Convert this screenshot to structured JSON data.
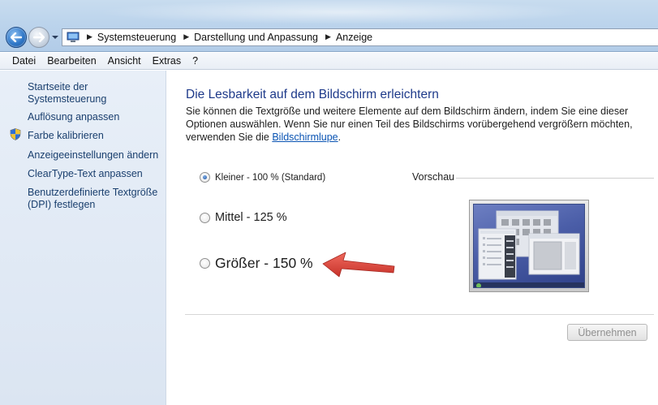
{
  "address_bar": {
    "breadcrumbs": [
      "Systemsteuerung",
      "Darstellung und Anpassung",
      "Anzeige"
    ]
  },
  "menu": [
    "Datei",
    "Bearbeiten",
    "Ansicht",
    "Extras",
    "?"
  ],
  "sidebar": {
    "home": "Startseite der Systemsteuerung",
    "links": [
      "Auflösung anpassen",
      "Farbe kalibrieren",
      "Anzeigeeinstellungen ändern",
      "ClearType-Text anpassen",
      "Benutzerdefinierte Textgröße (DPI) festlegen"
    ]
  },
  "main": {
    "title": "Die Lesbarkeit auf dem Bildschirm erleichtern",
    "intro": "Sie können die Textgröße und weitere Elemente auf dem Bildschirm ändern, indem Sie eine dieser Optionen auswählen. Wenn Sie nur einen Teil des Bildschirms vorübergehend vergrößern möchten, verwenden Sie die",
    "intro_link": "Bildschirmlupe",
    "intro_end": ".",
    "options": [
      {
        "label": "Kleiner - 100 % (Standard)",
        "selected": true
      },
      {
        "label": "Mittel - 125 %",
        "selected": false
      },
      {
        "label": "Größer - 150 %",
        "selected": false
      }
    ],
    "preview_label": "Vorschau",
    "apply_button": "Übernehmen"
  },
  "colors": {
    "title_blue": "#1e3a8a",
    "link_blue": "#1a3f6e",
    "annotation_arrow": "#e0453a"
  },
  "icons": [
    "back-arrow-icon",
    "forward-arrow-icon",
    "control-panel-icon",
    "shield-icon",
    "red-arrow-annotation"
  ]
}
